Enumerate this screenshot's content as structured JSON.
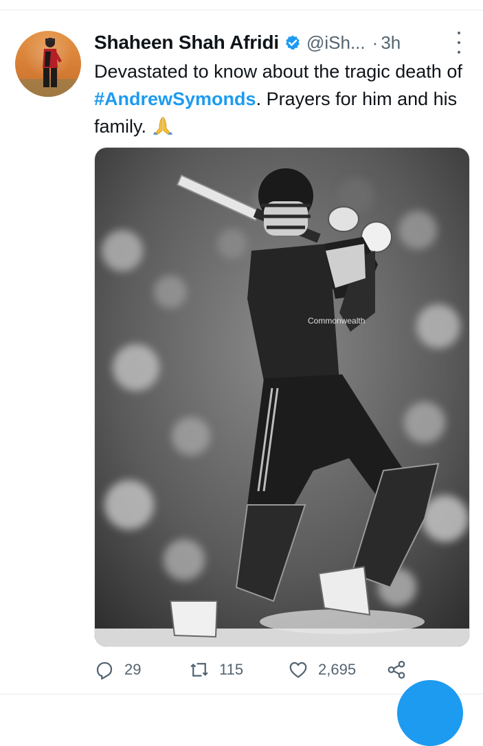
{
  "tweet": {
    "author": {
      "display_name": "Shaheen Shah Afridi",
      "handle": "@iSh...",
      "verified": true
    },
    "separator": "·",
    "time": "3h",
    "text": {
      "part1": "Devastated to know about the tragic death of ",
      "hashtag": "#AndrewSymonds",
      "part2": ". Prayers for him and his family."
    },
    "emoji_icon": "folded-hands-icon",
    "media": {
      "type": "black-and-white photo of a cricketer playing a shot",
      "jersey_text": "Commonwealth"
    },
    "actions": {
      "reply_count": "29",
      "retweet_count": "115",
      "like_count": "2,695"
    }
  },
  "icons": {
    "reply": "reply-icon",
    "retweet": "retweet-icon",
    "like": "heart-icon",
    "share": "share-icon",
    "more": "more-icon",
    "verified": "verified-badge-icon"
  },
  "colors": {
    "accent": "#1d9bf0",
    "text": "#0f1419",
    "secondary": "#536471"
  }
}
